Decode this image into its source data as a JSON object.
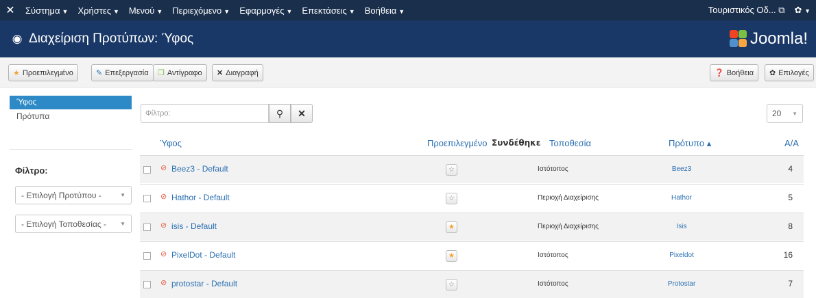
{
  "topnav": {
    "menu": [
      "Σύστημα",
      "Χρήστες",
      "Μενού",
      "Περιεχόμενο",
      "Εφαρμογές",
      "Επεκτάσεις",
      "Βοήθεια"
    ],
    "site_link": "Τουριστικός Οδ...",
    "site_link_icon": "external-link-icon",
    "user_icon": "gear-icon"
  },
  "header": {
    "title": "Διαχείριση Προτύπων: Ύφος",
    "brand": "Joomla!"
  },
  "toolbar": {
    "default_label": "Προεπιλεγμένο",
    "edit_label": "Επεξεργασία",
    "copy_label": "Αντίγραφο",
    "delete_label": "Διαγραφή",
    "help_label": "Βοήθεια",
    "options_label": "Επιλογές"
  },
  "sidebar": {
    "items": [
      "Ύφος",
      "Πρότυπα"
    ],
    "filter_label": "Φίλτρο:",
    "template_select": "- Επιλογή Προτύπου -",
    "location_select": "- Επιλογή Τοποθεσίας -"
  },
  "search": {
    "placeholder": "Φίλτρο:",
    "limit": "20"
  },
  "table": {
    "headers": {
      "style": "Ύφος",
      "default": "Προεπιλεγμένο",
      "assigned": "Συνδέθηκε",
      "location": "Τοποθεσία",
      "template": "Πρότυπο ▴",
      "id": "Α/Α"
    },
    "rows": [
      {
        "name": "Beez3 - Default",
        "default": false,
        "location": "Ιστότοπος",
        "template": "Beez3",
        "id": "4"
      },
      {
        "name": "Hathor - Default",
        "default": false,
        "location": "Περιοχή Διαχείρισης",
        "template": "Hathor",
        "id": "5"
      },
      {
        "name": "isis - Default",
        "default": true,
        "location": "Περιοχή Διαχείρισης",
        "template": "Isis",
        "id": "8"
      },
      {
        "name": "PixelDot - Default",
        "default": true,
        "location": "Ιστότοπος",
        "template": "Pixeldot",
        "id": "16"
      },
      {
        "name": "protostar - Default",
        "default": false,
        "location": "Ιστότοπος",
        "template": "Protostar",
        "id": "7"
      }
    ]
  },
  "colors": {
    "topnav_bg": "#1a2f4c",
    "header_bg": "#1a3867",
    "accent": "#2d8ac7",
    "link": "#2a6fb1",
    "star_on": "#f0a32e"
  }
}
